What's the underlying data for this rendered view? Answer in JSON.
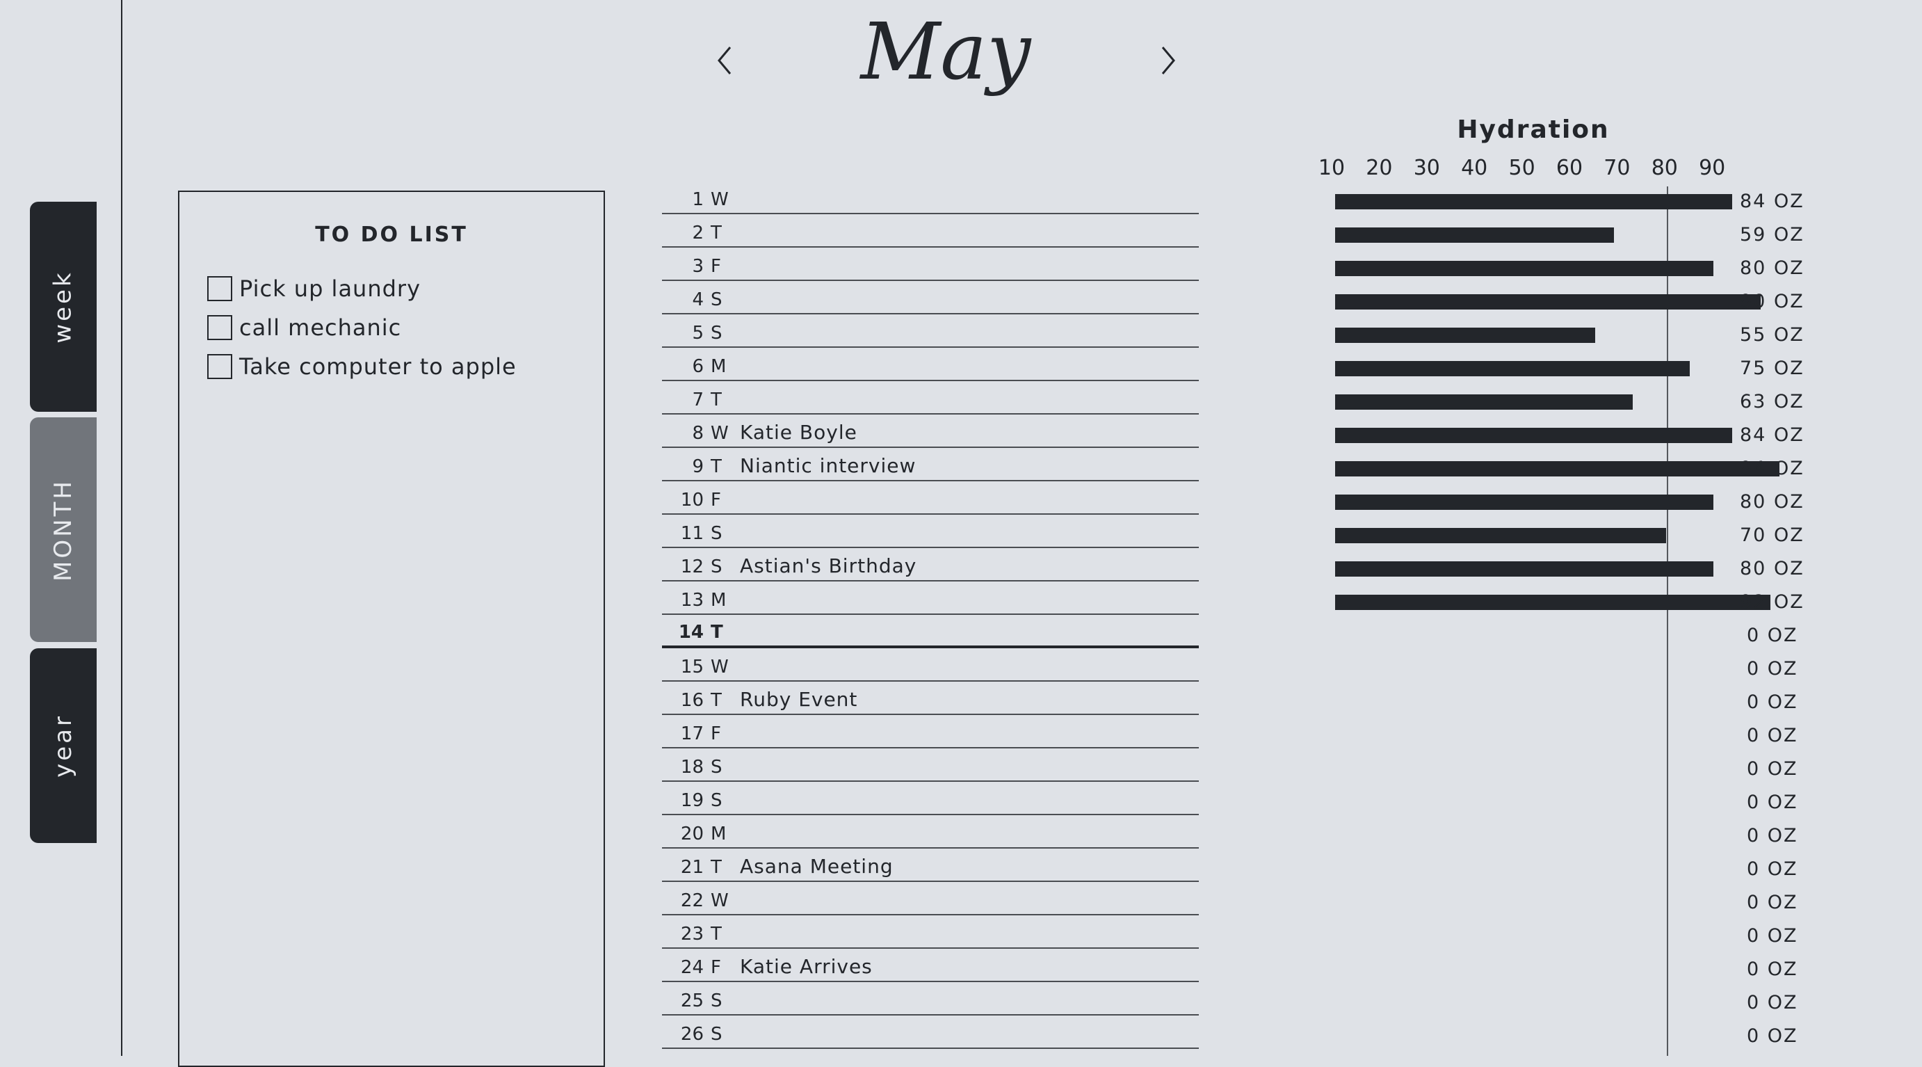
{
  "tabs": {
    "week": "week",
    "month": "MONTH",
    "year": "year"
  },
  "header": {
    "month": "May",
    "prev_icon": "chevron-left-icon",
    "next_icon": "chevron-right-icon"
  },
  "todo": {
    "title": "TO DO LIST",
    "items": [
      {
        "label": "Pick up laundry",
        "checked": false
      },
      {
        "label": "call mechanic",
        "checked": false
      },
      {
        "label": "Take computer to apple",
        "checked": false
      }
    ]
  },
  "days": [
    {
      "num": "1",
      "dow": "W",
      "event": ""
    },
    {
      "num": "2",
      "dow": "T",
      "event": ""
    },
    {
      "num": "3",
      "dow": "F",
      "event": ""
    },
    {
      "num": "4",
      "dow": "S",
      "event": ""
    },
    {
      "num": "5",
      "dow": "S",
      "event": ""
    },
    {
      "num": "6",
      "dow": "M",
      "event": ""
    },
    {
      "num": "7",
      "dow": "T",
      "event": ""
    },
    {
      "num": "8",
      "dow": "W",
      "event": "Katie Boyle"
    },
    {
      "num": "9",
      "dow": "T",
      "event": "Niantic interview"
    },
    {
      "num": "10",
      "dow": "F",
      "event": ""
    },
    {
      "num": "11",
      "dow": "S",
      "event": ""
    },
    {
      "num": "12",
      "dow": "S",
      "event": "Astian's Birthday"
    },
    {
      "num": "13",
      "dow": "M",
      "event": ""
    },
    {
      "num": "14",
      "dow": "T",
      "event": "",
      "today": true
    },
    {
      "num": "15",
      "dow": "W",
      "event": ""
    },
    {
      "num": "16",
      "dow": "T",
      "event": "Ruby Event"
    },
    {
      "num": "17",
      "dow": "F",
      "event": ""
    },
    {
      "num": "18",
      "dow": "S",
      "event": ""
    },
    {
      "num": "19",
      "dow": "S",
      "event": ""
    },
    {
      "num": "20",
      "dow": "M",
      "event": ""
    },
    {
      "num": "21",
      "dow": "T",
      "event": "Asana Meeting"
    },
    {
      "num": "22",
      "dow": "W",
      "event": ""
    },
    {
      "num": "23",
      "dow": "T",
      "event": ""
    },
    {
      "num": "24",
      "dow": "F",
      "event": "Katie Arrives"
    },
    {
      "num": "25",
      "dow": "S",
      "event": ""
    },
    {
      "num": "26",
      "dow": "S",
      "event": ""
    }
  ],
  "hydration": {
    "title": "Hydration",
    "unit": "OZ",
    "x_ticks": [
      "10",
      "20",
      "30",
      "40",
      "50",
      "60",
      "70",
      "80",
      "90"
    ]
  },
  "chart_data": {
    "type": "bar",
    "orientation": "horizontal",
    "title": "Hydration",
    "categories": [
      "1",
      "2",
      "3",
      "4",
      "5",
      "6",
      "7",
      "8",
      "9",
      "10",
      "11",
      "12",
      "13",
      "14",
      "15",
      "16",
      "17",
      "18",
      "19",
      "20",
      "21",
      "22",
      "23",
      "24",
      "25",
      "26"
    ],
    "values": [
      84,
      59,
      80,
      90,
      55,
      75,
      63,
      84,
      94,
      80,
      70,
      80,
      92,
      0,
      0,
      0,
      0,
      0,
      0,
      0,
      0,
      0,
      0,
      0,
      0,
      0
    ],
    "value_labels": [
      "84 OZ",
      "59 OZ",
      "80 OZ",
      "90 OZ",
      "55 OZ",
      "75 OZ",
      "63 OZ",
      "84 OZ",
      "94 OZ",
      "80 OZ",
      "70 OZ",
      "80 OZ",
      "92 OZ",
      "0 OZ",
      "0 OZ",
      "0 OZ",
      "0 OZ",
      "0 OZ",
      "0 OZ",
      "0 OZ",
      "0 OZ",
      "0 OZ",
      "0 OZ",
      "0 OZ",
      "0 OZ",
      "0 OZ"
    ],
    "xlim": [
      0,
      94
    ],
    "reference_line": 80,
    "grid": false
  }
}
